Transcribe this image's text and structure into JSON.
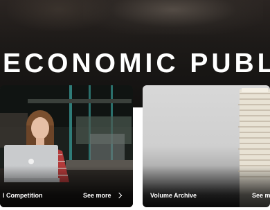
{
  "hero": {
    "title": "ECONOMIC PUBL"
  },
  "cards": [
    {
      "label": "l Competition",
      "see_more": "See more"
    },
    {
      "label": "Volume Archive",
      "see_more": "See m"
    }
  ]
}
